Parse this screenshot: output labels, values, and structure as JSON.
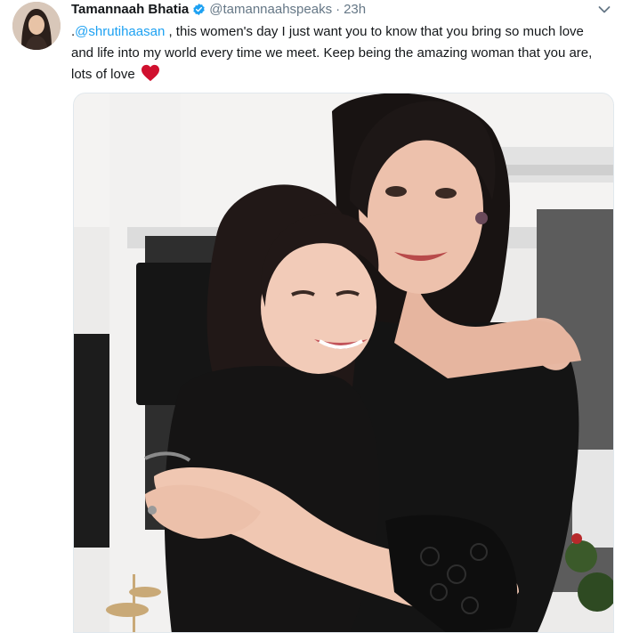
{
  "tweet": {
    "author_name": "Tamannaah Bhatia",
    "handle": "@tamannaahspeaks",
    "separator": "·",
    "time": "23h",
    "text_prefix": ".",
    "mention": "@shrutihaasan",
    "text_rest": " , this women's day I just want you to know that you bring so much love and life into my world every time we meet. Keep being the amazing woman that you are, lots of love ",
    "verified": true,
    "emoji_icon": "red-heart-icon"
  },
  "colors": {
    "mention": "#1da1f2",
    "verified_badge": "#1da1f2",
    "heart": "#d0102e",
    "muted": "#657786"
  }
}
